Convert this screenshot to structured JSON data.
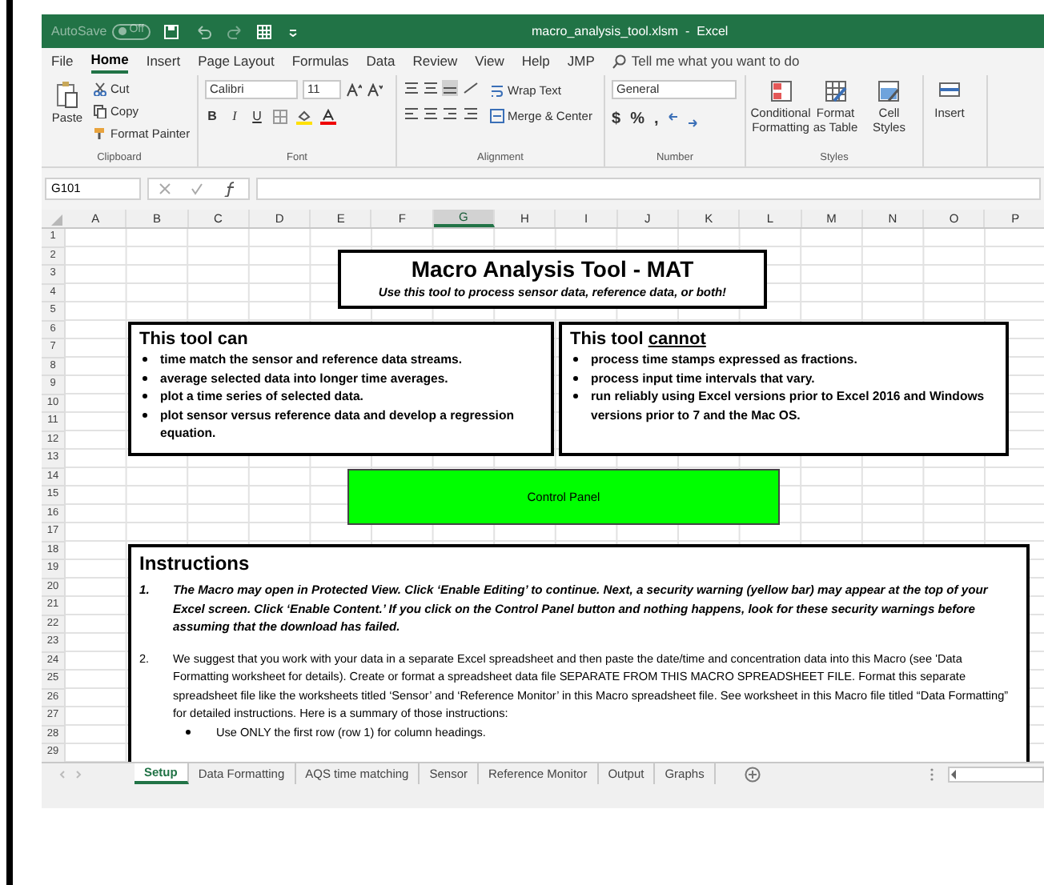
{
  "window": {
    "title": "macro_analysis_tool.xlsm  -  Excel"
  },
  "quick_access": {
    "autosave_label": "AutoSave",
    "autosave_state": "Off",
    "autosave_on": false
  },
  "ribbon_tabs": [
    {
      "label": "File",
      "selected": false
    },
    {
      "label": "Home",
      "selected": true
    },
    {
      "label": "Insert",
      "selected": false
    },
    {
      "label": "Page Layout",
      "selected": false
    },
    {
      "label": "Formulas",
      "selected": false
    },
    {
      "label": "Data",
      "selected": false
    },
    {
      "label": "Review",
      "selected": false
    },
    {
      "label": "View",
      "selected": false
    },
    {
      "label": "Help",
      "selected": false
    },
    {
      "label": "JMP",
      "selected": false
    }
  ],
  "tell_me": {
    "placeholder": "Tell me what you want to do"
  },
  "clipboard": {
    "name": "Clipboard",
    "paste": "Paste",
    "cut": "Cut",
    "copy": "Copy",
    "format_painter": "Format Painter"
  },
  "font": {
    "name": "Font",
    "family": "Calibri",
    "size": "11",
    "buttons": [
      "B",
      "I",
      "U"
    ]
  },
  "alignment": {
    "name": "Alignment",
    "wrap": "Wrap Text",
    "merge": "Merge & Center"
  },
  "number": {
    "name": "Number",
    "format": "General",
    "buttons": [
      "$",
      "%",
      ","
    ]
  },
  "styles": {
    "name": "Styles",
    "commands": [
      "Conditional Formatting",
      "Format as Table",
      "Cell Styles"
    ]
  },
  "cells": {
    "commands": [
      "Insert"
    ]
  },
  "formula_bar": {
    "name_box": "G101"
  },
  "columns": [
    {
      "label": "A",
      "selected": false
    },
    {
      "label": "B",
      "selected": false
    },
    {
      "label": "C",
      "selected": false
    },
    {
      "label": "D",
      "selected": false
    },
    {
      "label": "E",
      "selected": false
    },
    {
      "label": "F",
      "selected": false
    },
    {
      "label": "G",
      "selected": true
    },
    {
      "label": "H",
      "selected": false
    },
    {
      "label": "I",
      "selected": false
    },
    {
      "label": "J",
      "selected": false
    },
    {
      "label": "K",
      "selected": false
    },
    {
      "label": "L",
      "selected": false
    },
    {
      "label": "M",
      "selected": false
    },
    {
      "label": "N",
      "selected": false
    },
    {
      "label": "O",
      "selected": false
    },
    {
      "label": "P",
      "selected": false
    }
  ],
  "rows": [
    "1",
    "2",
    "3",
    "4",
    "5",
    "6",
    "7",
    "8",
    "9",
    "10",
    "11",
    "12",
    "13",
    "14",
    "15",
    "16",
    "17",
    "18",
    "19",
    "20",
    "21",
    "22",
    "23",
    "24",
    "25",
    "26",
    "27",
    "28",
    "29"
  ],
  "sheet": {
    "title": "Macro Analysis Tool - MAT",
    "subtitle": "Use this tool to process sensor data, reference data, or both!",
    "can_box": {
      "heading": "This tool can",
      "items": [
        "time match the sensor and reference data streams.",
        "average selected data into longer time averages.",
        "plot a time series of selected data.",
        "plot sensor versus reference data and develop a regression equation."
      ]
    },
    "cannot_box": {
      "heading": "This tool",
      "emphasis": "cannot",
      "items": [
        "process time stamps expressed as fractions.",
        "process input time intervals that vary.",
        "run reliably using Excel versions prior to Excel 2016 and Windows versions prior to 7 and the Mac OS."
      ]
    },
    "control_panel": {
      "label": "Control Panel"
    },
    "instructions": {
      "heading": "Instructions",
      "items": [
        {
          "number": "1.",
          "kind": "bold_italic",
          "text": "The Macro may open in Protected View.  Click ‘Enable Editing’ to continue. Next, a security warning (yellow bar) may appear at the top of your Excel screen.  Click ‘Enable Content.’  If you click on the Control Panel button and nothing happens, look for these security warnings before assuming that the download has failed."
        },
        {
          "number": "2.",
          "kind": "plain",
          "text": "We suggest that you work with your data in a separate Excel spreadsheet and then paste the date/time and concentration data into this Macro (see 'Data Formatting worksheet for details). Create or format a spreadsheet data file SEPARATE FROM THIS MACRO SPREADSHEET FILE. Format this separate spreadsheet file like the worksheets titled ‘Sensor’ and ‘Reference Monitor’ in this Macro spreadsheet file. See worksheet in this Macro file titled “Data Formatting” for detailed instructions.  Here is a summary of those instructions:",
          "bullets": [
            "Use ONLY the first row (row 1) for column headings."
          ]
        }
      ]
    }
  },
  "sheet_tabs": [
    {
      "label": "Setup",
      "selected": true
    },
    {
      "label": "Data Formatting",
      "selected": false
    },
    {
      "label": "AQS time matching",
      "selected": false
    },
    {
      "label": "Sensor",
      "selected": false
    },
    {
      "label": "Reference Monitor",
      "selected": false
    },
    {
      "label": "Output",
      "selected": false
    },
    {
      "label": "Graphs",
      "selected": false
    }
  ]
}
